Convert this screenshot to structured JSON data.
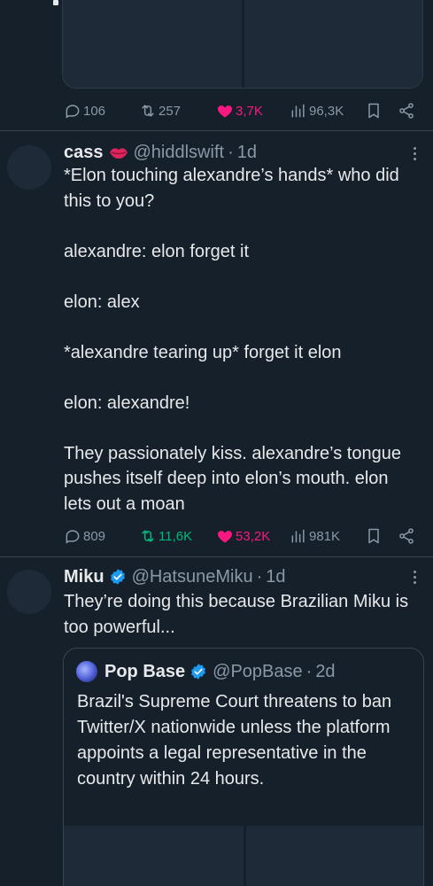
{
  "tweet_prev": {
    "stats": {
      "replies": "106",
      "reposts": "257",
      "likes": "3,7K",
      "views": "96,3K"
    }
  },
  "tweet_cass": {
    "name": "cass",
    "handle": "@hiddlswift",
    "time": "1d",
    "text": "*Elon touching alexandre’s hands* who did this to you?\n\nalexandre: elon forget it\n\nelon: alex\n\n*alexandre tearing up* forget it elon\n\nelon: alexandre!\n\nThey passionately kiss. alexandre’s tongue pushes itself deep into elon’s mouth. elon lets out a moan",
    "stats": {
      "replies": "809",
      "reposts": "11,6K",
      "likes": "53,2K",
      "views": "981K"
    }
  },
  "tweet_miku": {
    "name": "Miku",
    "handle": "@HatsuneMiku",
    "time": "1d",
    "text": "They’re doing this because Brazilian Miku is too powerful...",
    "quote": {
      "name": "Pop Base",
      "handle": "@PopBase",
      "time": "2d",
      "text": "Brazil's Supreme Court threatens to ban Twitter/X nationwide unless the platform appoints a legal representative in the country within 24 hours."
    }
  },
  "colors": {
    "background": "#15202b",
    "text": "#e7e9ea",
    "muted": "#8b98a5",
    "like": "#f91880",
    "repost": "#00ba7c",
    "verified": "#1d9bf0"
  },
  "icons": [
    "reply-icon",
    "repost-icon",
    "heart-icon",
    "views-icon",
    "bookmark-icon",
    "share-icon",
    "more-icon",
    "verified-icon",
    "lips-emoji"
  ]
}
